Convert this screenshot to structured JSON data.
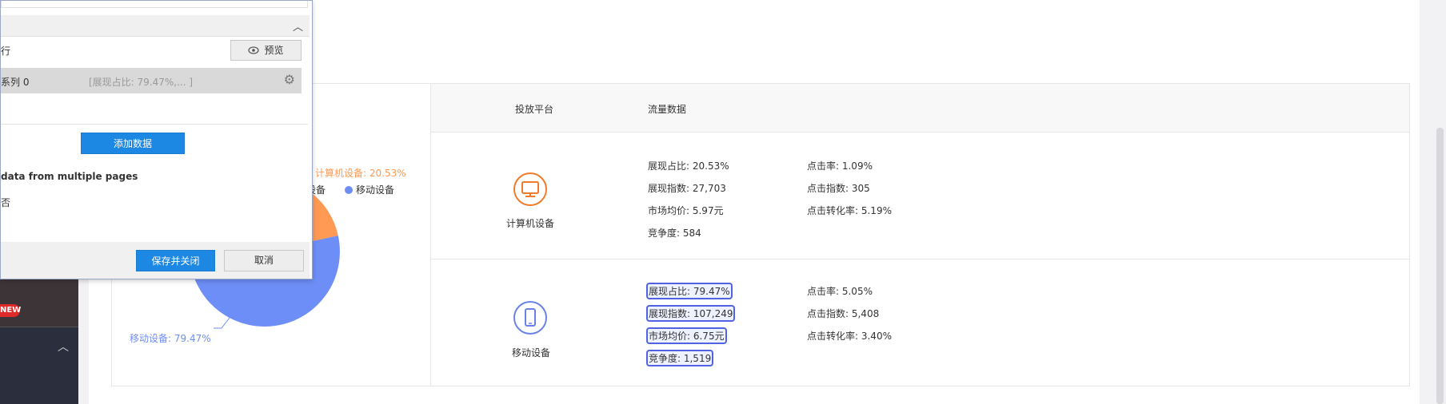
{
  "nav": {
    "new_badge": "NEW"
  },
  "dialog": {
    "row1_label": "行",
    "preview_button": "预览",
    "series_label": "系列 0",
    "series_preview": "[展现占比: 79.47%,... ]",
    "add_data_button": "添加数据",
    "multi_page_label": "data from multiple pages",
    "option_label": "否",
    "save_close_button": "保存并关闭",
    "cancel_button": "取消"
  },
  "legend": {
    "computer": "设备",
    "mobile": "移动设备"
  },
  "pie": {
    "computer_label": "计算机设备: 20.53%",
    "mobile_label": "移动设备: 79.47%",
    "colors": {
      "computer": "#ff9a54",
      "mobile": "#6e8ef7"
    }
  },
  "table": {
    "headers": {
      "platform": "投放平台",
      "traffic": "流量数据"
    },
    "rows": [
      {
        "platform": "计算机设备",
        "icon": "monitor-icon",
        "color": "#f07c2a",
        "left": [
          "展现占比: 20.53%",
          "展现指数: 27,703",
          "市场均价: 5.97元",
          "竞争度: 584"
        ],
        "right": [
          "点击率: 1.09%",
          "点击指数: 305",
          "点击转化率: 5.19%"
        ]
      },
      {
        "platform": "移动设备",
        "icon": "mobile-phone-icon",
        "color": "#6a82e8",
        "left": [
          "展现占比: 79.47%",
          "展现指数: 107,249",
          "市场均价: 6.75元",
          "竞争度: 1,519"
        ],
        "right": [
          "点击率: 5.05%",
          "点击指数: 5,408",
          "点击转化率: 3.40%"
        ]
      }
    ]
  }
}
